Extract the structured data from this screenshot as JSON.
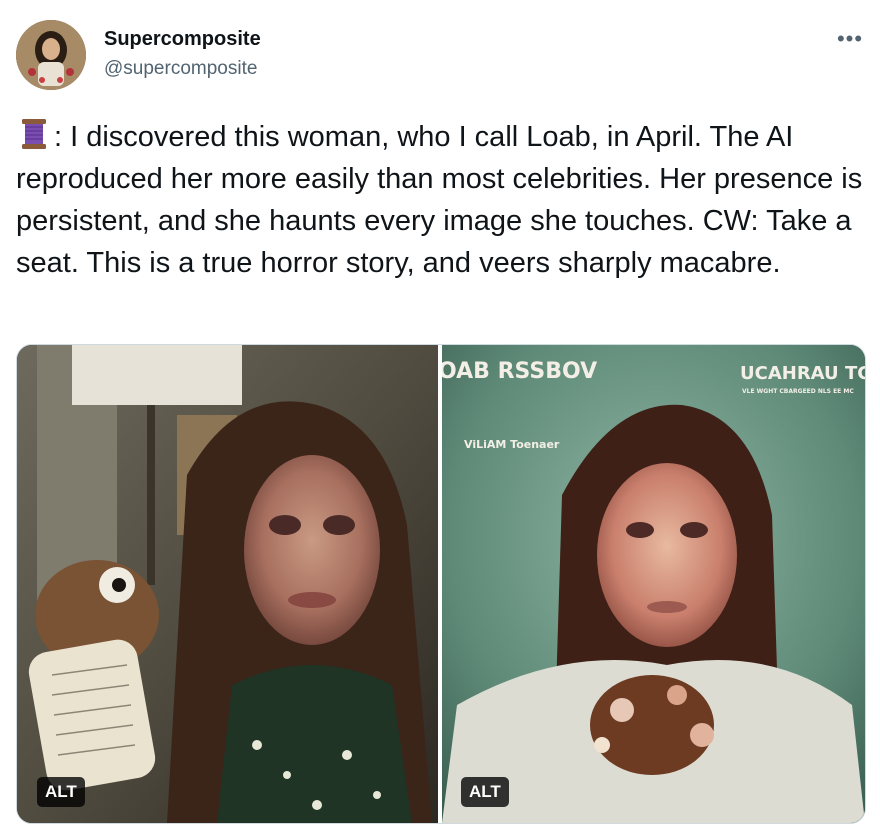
{
  "author": {
    "display_name": "Supercomposite",
    "handle": "@supercomposite",
    "avatar_icon": "profile-avatar-image"
  },
  "menu": {
    "more_label": "•••",
    "more_icon": "more-dots-icon"
  },
  "tweet": {
    "emoji_icon": "thread-spool-icon",
    "text": ": I discovered this woman, who I call Loab, in April. The AI reproduced her more easily than most celebrities. Her presence is persistent, and she haunts every image she touches. CW: Take a seat. This is a true horror story, and veers sharply macabre."
  },
  "media": {
    "images": [
      {
        "alt_label": "ALT"
      },
      {
        "alt_label": "ALT",
        "cover_title_left": "OAB RSSBOV",
        "cover_title_right": "UCAHRAU TC",
        "cover_small_text": "VLE WGHT CBARGEED NLS EE MC",
        "cover_byline": "ViLiAM Toenaer"
      }
    ]
  },
  "colors": {
    "text": "#0f1419",
    "secondary": "#536471",
    "border": "#cfd9de",
    "spool_purple": "#7b4db0"
  }
}
